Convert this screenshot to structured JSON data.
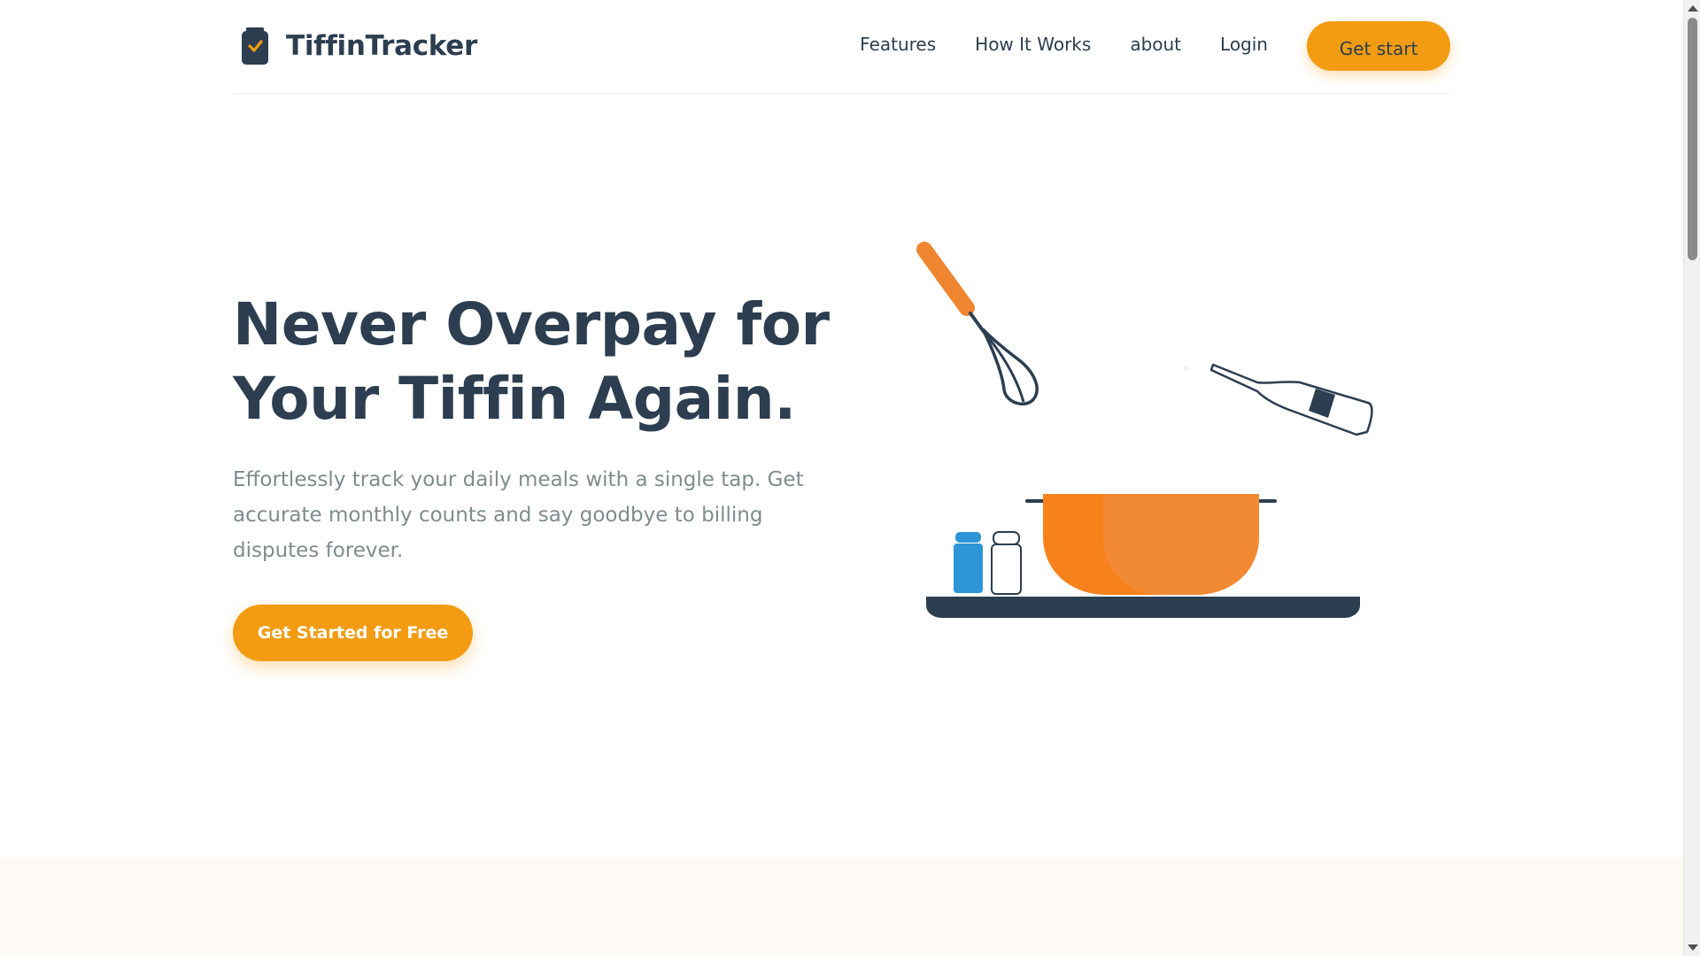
{
  "brand": {
    "name": "TiffinTracker",
    "logo_icon": "jar-check-icon"
  },
  "nav": {
    "links": [
      "Features",
      "How It Works",
      "about",
      "Login"
    ],
    "cta_label": "Get start"
  },
  "hero": {
    "title_line1": "Never Overpay for",
    "title_line2": "Your Tiffin Again.",
    "subtitle": "Effortlessly track your daily meals with a single tap. Get accurate monthly counts and say goodbye to billing disputes forever.",
    "cta_label": "Get Started for Free",
    "illustration": "cooking-illustration"
  },
  "colors": {
    "accent": "#f39c12",
    "text_dark": "#2c3e50",
    "text_muted": "#7f8c8d",
    "pot_orange": "#f7821b",
    "pot_orange_light": "#f28a33",
    "shaker_blue": "#2b95d6",
    "section_bg": "#fdfaf6"
  }
}
